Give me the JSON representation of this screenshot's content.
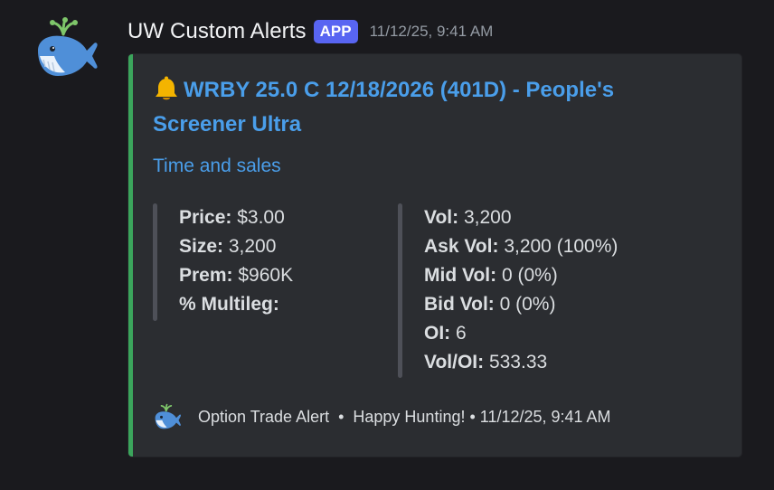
{
  "message": {
    "avatar_icon": "whale-icon",
    "username": "UW Custom Alerts",
    "badge": "APP",
    "timestamp": "11/12/25, 9:41 AM"
  },
  "embed": {
    "accent_color": "#3ba55c",
    "title_icon": "bell-icon",
    "title": "WRBY 25.0 C 12/18/2026 (401D) - People's Screener Ultra",
    "description": "Time and sales",
    "fields_left": [
      {
        "label": "Price:",
        "value": "$3.00"
      },
      {
        "label": "Size:",
        "value": "3,200"
      },
      {
        "label": "Prem:",
        "value": "$960K"
      },
      {
        "label": "% Multileg:",
        "value": ""
      }
    ],
    "fields_right": [
      {
        "label": "Vol:",
        "value": "3,200"
      },
      {
        "label": "Ask Vol:",
        "value": "3,200 (100%)"
      },
      {
        "label": "Mid Vol:",
        "value": "0 (0%)"
      },
      {
        "label": "Bid Vol:",
        "value": "0 (0%)"
      },
      {
        "label": "OI:",
        "value": "6"
      },
      {
        "label": "Vol/OI:",
        "value": "533.33"
      }
    ],
    "footer": {
      "icon": "whale-icon",
      "text": "Option Trade Alert  •  Happy Hunting! • 11/12/25, 9:41 AM"
    }
  }
}
